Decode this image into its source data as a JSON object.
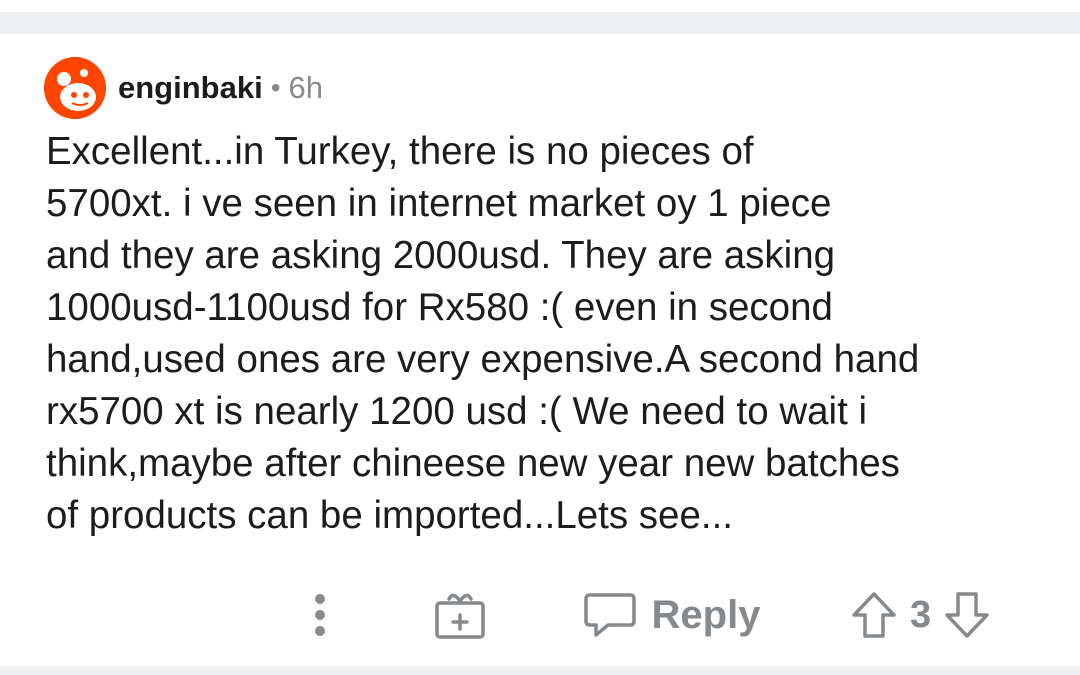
{
  "comment": {
    "author": "enginbaki",
    "separator": "•",
    "age": "6h",
    "body": "Excellent...in Turkey, there is no pieces of\n5700xt. i ve seen in internet market oy 1 piece\nand they are asking 2000usd. They are asking\n1000usd-1100usd for Rx580 :( even in second\nhand,used ones are very expensive.A second hand\nrx5700 xt is nearly 1200 usd :( We need to wait i\nthink,maybe after chineese new year new batches\nof products can be imported...Lets see...",
    "score": "3"
  },
  "actions": {
    "reply_label": "Reply"
  },
  "icons": {
    "avatar": "reddit-snoo-avatar",
    "more": "more-vertical-icon",
    "award": "gift-award-icon",
    "reply": "speech-bubble-icon",
    "upvote": "arrow-up-icon",
    "downvote": "arrow-down-icon"
  },
  "colors": {
    "avatar_bg": "#ff4500",
    "text": "#1c1c1c",
    "muted": "#878a8c",
    "divider": "#edeff1"
  }
}
